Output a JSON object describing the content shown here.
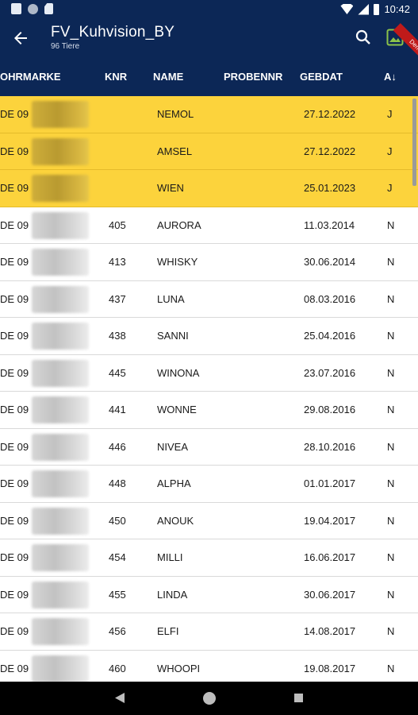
{
  "status_bar": {
    "time": "10:42",
    "icons": [
      "notification-icon",
      "circle-icon",
      "sd-card-icon",
      "wifi-icon",
      "signal-icon",
      "battery-icon"
    ]
  },
  "app_bar": {
    "title": "FV_Kuhvision_BY",
    "subtitle": "96 Tiere",
    "back_icon": "arrow-left-icon",
    "search_icon": "search-icon",
    "image_icon": "image-icon",
    "ribbon": "Demo",
    "accent_color": "#0c2756",
    "image_icon_color": "#8bc34a"
  },
  "table": {
    "headers": {
      "ohrmarke": "OHRMARKE",
      "knr": "KNR",
      "name": "NAME",
      "probennr": "PROBENNR",
      "gebdat": "GEBDAT",
      "a": "A↓"
    },
    "highlight_color": "#fcd33c",
    "rows": [
      {
        "ohrmarke": "DE 09",
        "knr": "",
        "name": "NEMOL",
        "probennr": "",
        "gebdat": "27.12.2022",
        "a": "J",
        "highlight": true
      },
      {
        "ohrmarke": "DE 09",
        "knr": "",
        "name": "AMSEL",
        "probennr": "",
        "gebdat": "27.12.2022",
        "a": "J",
        "highlight": true
      },
      {
        "ohrmarke": "DE 09",
        "knr": "",
        "name": "WIEN",
        "probennr": "",
        "gebdat": "25.01.2023",
        "a": "J",
        "highlight": true
      },
      {
        "ohrmarke": "DE 09",
        "knr": "405",
        "name": "AURORA",
        "probennr": "",
        "gebdat": "11.03.2014",
        "a": "N",
        "highlight": false
      },
      {
        "ohrmarke": "DE 09",
        "knr": "413",
        "name": "WHISKY",
        "probennr": "",
        "gebdat": "30.06.2014",
        "a": "N",
        "highlight": false
      },
      {
        "ohrmarke": "DE 09",
        "knr": "437",
        "name": "LUNA",
        "probennr": "",
        "gebdat": "08.03.2016",
        "a": "N",
        "highlight": false
      },
      {
        "ohrmarke": "DE 09",
        "knr": "438",
        "name": "SANNI",
        "probennr": "",
        "gebdat": "25.04.2016",
        "a": "N",
        "highlight": false
      },
      {
        "ohrmarke": "DE 09",
        "knr": "445",
        "name": "WINONA",
        "probennr": "",
        "gebdat": "23.07.2016",
        "a": "N",
        "highlight": false
      },
      {
        "ohrmarke": "DE 09",
        "knr": "441",
        "name": "WONNE",
        "probennr": "",
        "gebdat": "29.08.2016",
        "a": "N",
        "highlight": false
      },
      {
        "ohrmarke": "DE 09",
        "knr": "446",
        "name": "NIVEA",
        "probennr": "",
        "gebdat": "28.10.2016",
        "a": "N",
        "highlight": false
      },
      {
        "ohrmarke": "DE 09",
        "knr": "448",
        "name": "ALPHA",
        "probennr": "",
        "gebdat": "01.01.2017",
        "a": "N",
        "highlight": false
      },
      {
        "ohrmarke": "DE 09",
        "knr": "450",
        "name": "ANOUK",
        "probennr": "",
        "gebdat": "19.04.2017",
        "a": "N",
        "highlight": false
      },
      {
        "ohrmarke": "DE 09",
        "knr": "454",
        "name": "MILLI",
        "probennr": "",
        "gebdat": "16.06.2017",
        "a": "N",
        "highlight": false
      },
      {
        "ohrmarke": "DE 09",
        "knr": "455",
        "name": "LINDA",
        "probennr": "",
        "gebdat": "30.06.2017",
        "a": "N",
        "highlight": false
      },
      {
        "ohrmarke": "DE 09",
        "knr": "456",
        "name": "ELFI",
        "probennr": "",
        "gebdat": "14.08.2017",
        "a": "N",
        "highlight": false
      },
      {
        "ohrmarke": "DE 09",
        "knr": "460",
        "name": "WHOOPI",
        "probennr": "",
        "gebdat": "19.08.2017",
        "a": "N",
        "highlight": false
      }
    ]
  },
  "nav_bar": {
    "icons": [
      "nav-back-icon",
      "nav-home-icon",
      "nav-recents-icon"
    ]
  }
}
